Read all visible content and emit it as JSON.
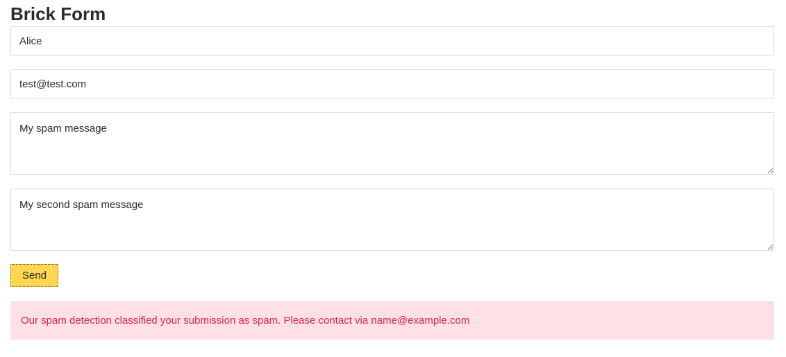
{
  "form": {
    "title": "Brick Form",
    "name_value": "Alice",
    "email_value": "test@test.com",
    "message_value": "My spam message",
    "second_message_value": "My second spam message",
    "send_label": "Send"
  },
  "alert": {
    "message": "Our spam detection classified your submission as spam. Please contact via name@example.com"
  },
  "colors": {
    "button": "#ffd64f",
    "alert_bg": "#ffe0e6",
    "alert_text": "#e0244c"
  }
}
